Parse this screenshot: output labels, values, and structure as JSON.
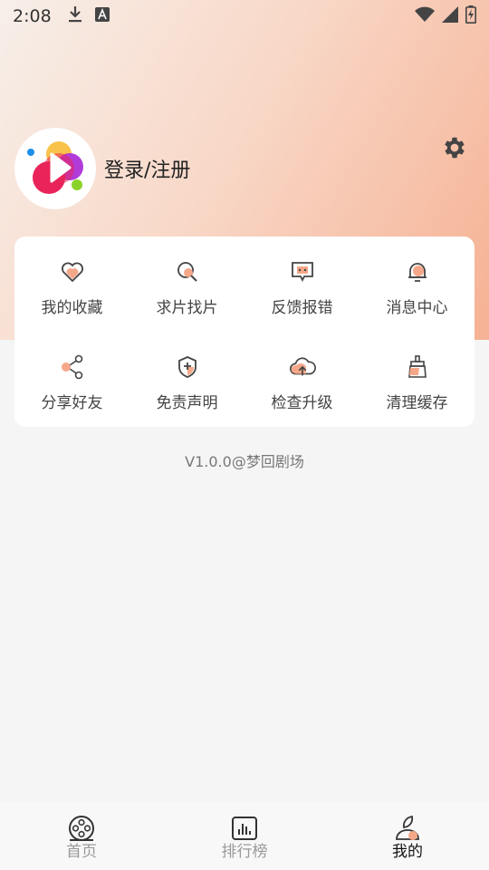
{
  "status_bar": {
    "time": "2:08",
    "icons": [
      "download-icon",
      "text-a-icon",
      "wifi-icon",
      "signal-icon",
      "battery-charging-icon"
    ]
  },
  "profile": {
    "avatar_icon": "app-logo-icon",
    "login_label": "登录/注册",
    "settings_icon": "gear-icon"
  },
  "menu": {
    "items": [
      {
        "label": "我的收藏",
        "icon": "heart-icon"
      },
      {
        "label": "求片找片",
        "icon": "search-film-icon"
      },
      {
        "label": "反馈报错",
        "icon": "feedback-chat-icon"
      },
      {
        "label": "消息中心",
        "icon": "bell-icon"
      },
      {
        "label": "分享好友",
        "icon": "share-icon"
      },
      {
        "label": "免责声明",
        "icon": "shield-icon"
      },
      {
        "label": "检查升级",
        "icon": "cloud-upload-icon"
      },
      {
        "label": "清理缓存",
        "icon": "broom-icon"
      }
    ]
  },
  "version": "V1.0.0@梦回剧场",
  "bottom_nav": {
    "tabs": [
      {
        "label": "首页",
        "icon": "film-reel-icon",
        "active": false
      },
      {
        "label": "排行榜",
        "icon": "bar-chart-icon",
        "active": false
      },
      {
        "label": "我的",
        "icon": "user-icon",
        "active": true
      }
    ]
  },
  "colors": {
    "accent": "#f5a889",
    "header_gradient_end": "#f6b193",
    "background": "#f5f5f5"
  }
}
